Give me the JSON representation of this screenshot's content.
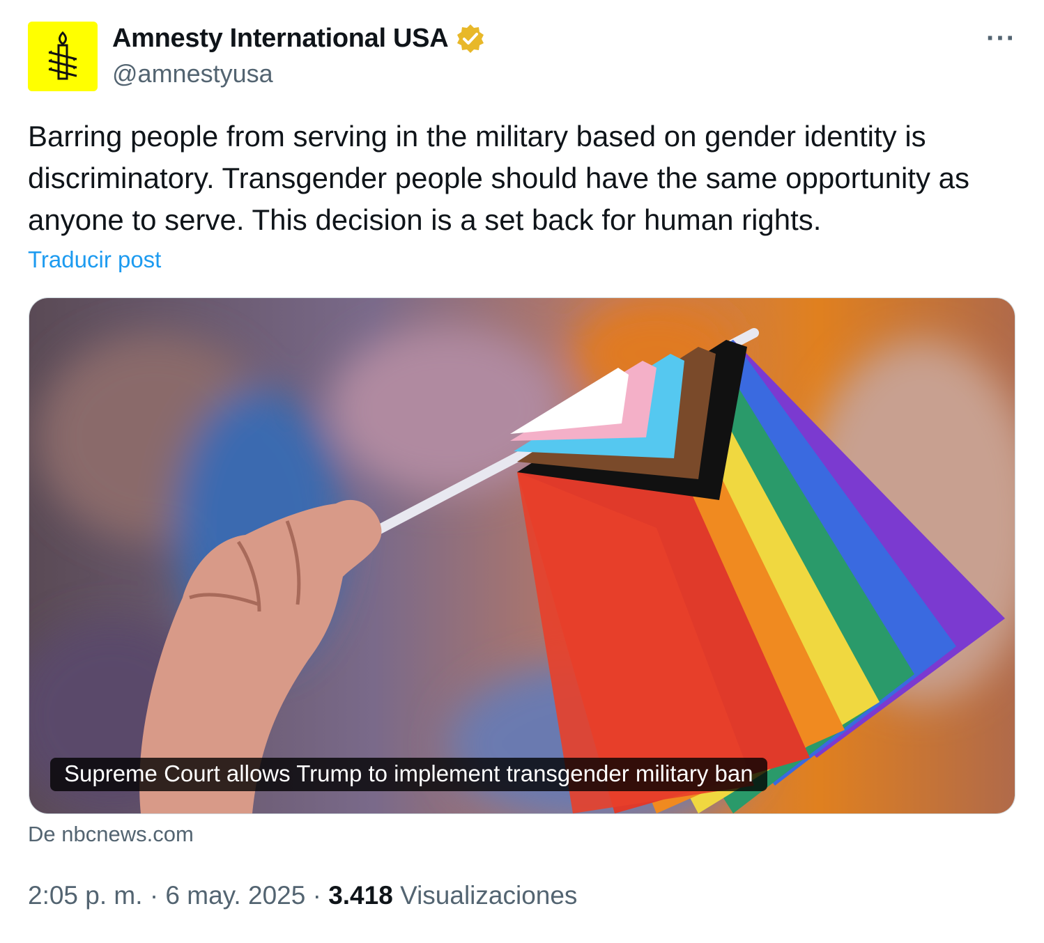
{
  "author": {
    "display_name": "Amnesty International USA",
    "handle": "@amnestyusa",
    "avatar_icon": "candle-barbed-wire-icon",
    "avatar_color": "#ffff00",
    "verified_icon": "verified-badge-icon",
    "verified_color": "#e8b829"
  },
  "more_menu": {
    "label": "···",
    "icon": "more-options-icon"
  },
  "tweet": {
    "text": "Barring people from serving in the military based on gender identity is discriminatory. Transgender people should have the same opportunity as anyone to serve. This decision is a set back for human rights.",
    "translate_label": "Traducir post"
  },
  "card": {
    "image_icon": "progress-pride-flag-photo",
    "title": "Supreme Court allows Trump to implement transgender military ban",
    "source": "De nbcnews.com"
  },
  "meta": {
    "time": "2:05 p. m.",
    "separator": "·",
    "date": "6 may. 2025",
    "views_count": "3.418",
    "views_label": "Visualizaciones"
  },
  "colors": {
    "text": "#0f1419",
    "secondary": "#536471",
    "link": "#1d9bf0"
  }
}
